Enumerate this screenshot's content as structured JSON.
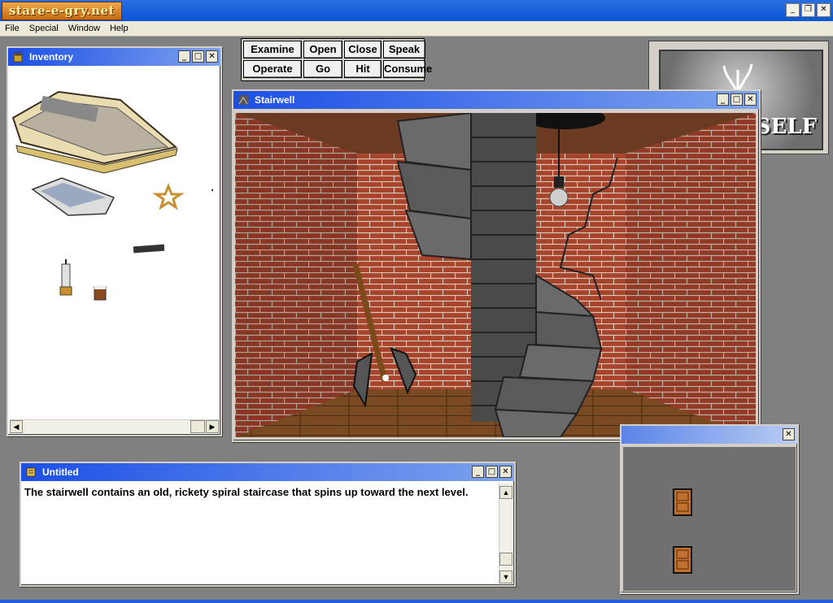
{
  "app": {
    "logo_text": "stare-e-gry.net"
  },
  "menu": [
    "File",
    "Special",
    "Window",
    "Help"
  ],
  "verbs": {
    "examine": "Examine",
    "open": "Open",
    "close": "Close",
    "speak": "Speak",
    "operate": "Operate",
    "go": "Go",
    "hit": "Hit",
    "consume": "Consume"
  },
  "inventory": {
    "title": "Inventory"
  },
  "stairwell": {
    "title": "Stairwell"
  },
  "self_panel": {
    "label": "SELF"
  },
  "narration": {
    "title": "Untitled",
    "text": "The stairwell contains an old, rickety spiral staircase that spins up toward the next level."
  },
  "exits": {
    "title": ""
  },
  "icons": {
    "inventory": "bag-icon",
    "stairwell": "room-icon",
    "narration": "scroll-icon"
  },
  "colors": {
    "title_active": "#1c4fe6",
    "brick": "#a8432c",
    "background": "#808080"
  }
}
